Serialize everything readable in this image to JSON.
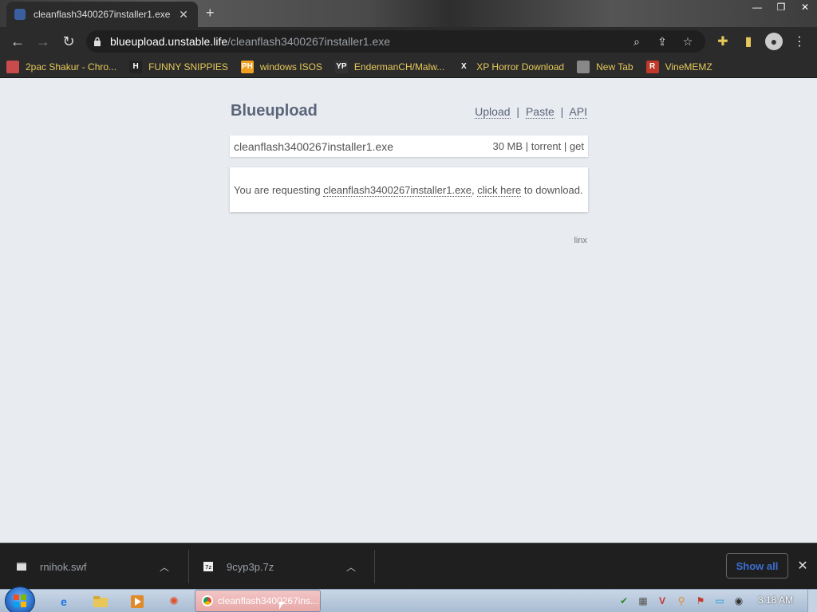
{
  "browser": {
    "tab": {
      "title": "cleanflash3400267installer1.exe",
      "close_icon": "close-icon"
    },
    "new_tab_label": "+",
    "window_controls": [
      "minimize",
      "maximize",
      "close"
    ],
    "url": {
      "host": "blueupload.unstable.life",
      "path": "/cleanflash3400267installer1.exe"
    }
  },
  "bookmarks": [
    {
      "label": "2pac Shakur - Chro...",
      "icon": "bag-icon",
      "color": "#c94b4b",
      "glyph": ""
    },
    {
      "label": "FUNNY SNIPPIES",
      "icon": "h-icon",
      "color": "#222222",
      "glyph": "H"
    },
    {
      "label": "windows ISOS",
      "icon": "ph-icon",
      "color": "#f0a020",
      "glyph": "PH"
    },
    {
      "label": "EndermanCH/Malw...",
      "icon": "yp-icon",
      "color": "#333333",
      "glyph": "YP"
    },
    {
      "label": "XP Horror Download",
      "icon": "x-icon",
      "color": "#2b2b2b",
      "glyph": "X"
    },
    {
      "label": "New Tab",
      "icon": "globe-icon",
      "color": "#888888",
      "glyph": ""
    },
    {
      "label": "VineMEMZ",
      "icon": "r-icon",
      "color": "#c0392b",
      "glyph": "R"
    }
  ],
  "site": {
    "title": "Blueupload",
    "nav": {
      "upload": "Upload",
      "paste": "Paste",
      "api": "API",
      "sep": "|"
    },
    "file": {
      "name": "cleanflash3400267installer1.exe",
      "size": "30 MB",
      "torrent": "torrent",
      "get": "get",
      "sep": "|"
    },
    "message": {
      "prefix": "You are requesting",
      "filename": "cleanflash3400267installer1.exe",
      "comma": ",",
      "link": "click here",
      "suffix": "to download."
    },
    "footer": "linx"
  },
  "downloads": {
    "items": [
      {
        "name": "rnihok.swf"
      },
      {
        "name": "9cyp3p.7z"
      }
    ],
    "show_all": "Show all"
  },
  "taskbar": {
    "active_window": "cleanflash3400267ins...",
    "clock": "3:18 AM"
  }
}
